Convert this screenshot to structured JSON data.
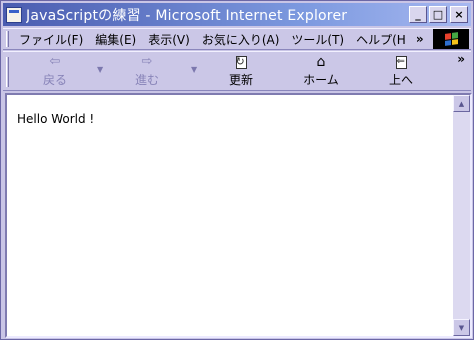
{
  "window": {
    "title": "JavaScriptの練習 - Microsoft Internet Explorer",
    "controls": {
      "minimize": "_",
      "maximize": "□",
      "close": "×"
    }
  },
  "menubar": {
    "items": [
      "ファイル(F)",
      "編集(E)",
      "表示(V)",
      "お気に入り(A)",
      "ツール(T)",
      "ヘルプ(H"
    ],
    "more": "»"
  },
  "toolbar": {
    "buttons": [
      {
        "label": "戻る",
        "icon": "back-arrow-icon",
        "glyph": "⇦",
        "enabled": false
      },
      {
        "label": "進む",
        "icon": "forward-arrow-icon",
        "glyph": "⇨",
        "enabled": false
      },
      {
        "label": "更新",
        "icon": "refresh-icon",
        "enabled": true
      },
      {
        "label": "ホーム",
        "icon": "home-icon",
        "glyph": "⌂",
        "enabled": true
      },
      {
        "label": "上へ",
        "icon": "up-folder-icon",
        "enabled": true
      }
    ],
    "dropdown_glyph": "▼",
    "more": "»"
  },
  "content": {
    "text": "Hello World !"
  },
  "scrollbar": {
    "up_glyph": "▲",
    "down_glyph": "▼"
  },
  "colors": {
    "title_gradient_start": "#4a5cb0",
    "title_gradient_end": "#a7b8f0",
    "chrome": "#cbc7e7",
    "disabled_text": "#8884b8"
  }
}
